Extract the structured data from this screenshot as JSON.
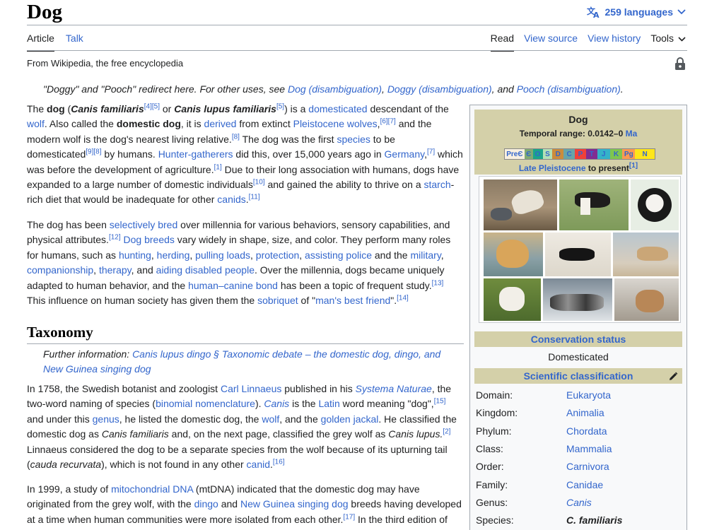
{
  "header": {
    "title": "Dog",
    "languages": "259 languages"
  },
  "tabs": {
    "article": "Article",
    "talk": "Talk",
    "read": "Read",
    "view_source": "View source",
    "view_history": "View history",
    "tools": "Tools"
  },
  "tagline": "From Wikipedia, the free encyclopedia",
  "hatnote": {
    "prefix": "\"Doggy\" and \"Pooch\" redirect here. For other uses, see ",
    "link1": "Dog (disambiguation)",
    "sep1": ", ",
    "link2": "Doggy (disambiguation)",
    "sep2": ", and ",
    "link3": "Pooch (disambiguation)",
    "suffix": "."
  },
  "sections": {
    "taxonomy": "Taxonomy",
    "further_prefix": "Further information: ",
    "further_link": "Canis lupus dingo § Taxonomic debate – the domestic dog, dingo, and New Guinea singing dog"
  },
  "infobox": {
    "title": "Dog",
    "range_label": "Temporal range: 0.0142–0 ",
    "range_unit": "Ma",
    "timebar": [
      "PreЄ",
      "Є",
      "O",
      "S",
      "D",
      "C",
      "P",
      "T",
      "J",
      "K",
      "Pg",
      "N"
    ],
    "late_link": "Late Pleistocene",
    "late_suffix": " to present",
    "late_ref": "[1]",
    "conservation_header": "Conservation status",
    "conservation_value": "Domesticated",
    "classification_header": "Scientific classification",
    "classification": [
      {
        "rank": "Domain:",
        "value": "Eukaryota"
      },
      {
        "rank": "Kingdom:",
        "value": "Animalia"
      },
      {
        "rank": "Phylum:",
        "value": "Chordata"
      },
      {
        "rank": "Class:",
        "value": "Mammalia"
      },
      {
        "rank": "Order:",
        "value": "Carnivora"
      },
      {
        "rank": "Family:",
        "value": "Canidae"
      },
      {
        "rank": "Genus:",
        "value": "Canis"
      },
      {
        "rank": "Species:",
        "value": "C. familiaris"
      }
    ]
  },
  "colors": {
    "link": "#3366cc",
    "infobox_header": "#d4d0a9",
    "text": "#202122"
  }
}
